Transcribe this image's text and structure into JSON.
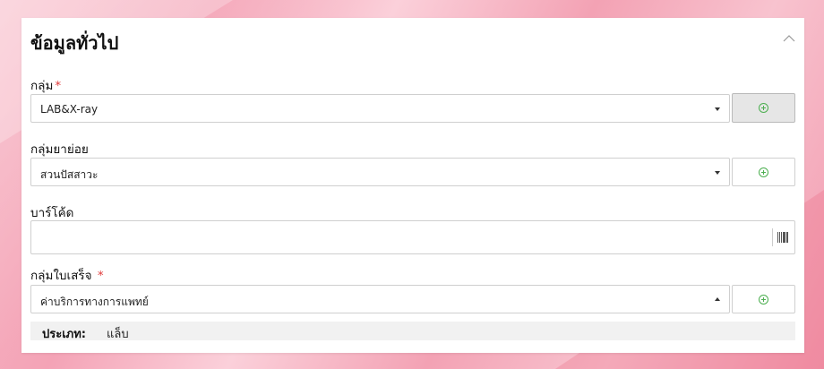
{
  "section": {
    "title": "ข้อมูลทั่วไป"
  },
  "fields": {
    "group": {
      "label": "กลุ่ม",
      "required_mark": "*",
      "value": "LAB&X-ray"
    },
    "subgroup": {
      "label": "กลุ่มยาย่อย",
      "value": "สวนปัสสาวะ"
    },
    "barcode": {
      "label": "บาร์โค้ด",
      "value": ""
    },
    "receipt_group": {
      "label": "กลุ่มใบเสร็จ",
      "required_mark": "*",
      "value": "ค่าบริการทางการแพทย์"
    }
  },
  "type_info": {
    "key": "ประเภท:",
    "value": "แล็บ"
  },
  "icons": {
    "add": "plus-circle-icon",
    "collapse": "chevron-up-icon",
    "barcode": "barcode-icon"
  },
  "colors": {
    "required": "#e03b3b",
    "add_icon": "#4caf50"
  }
}
